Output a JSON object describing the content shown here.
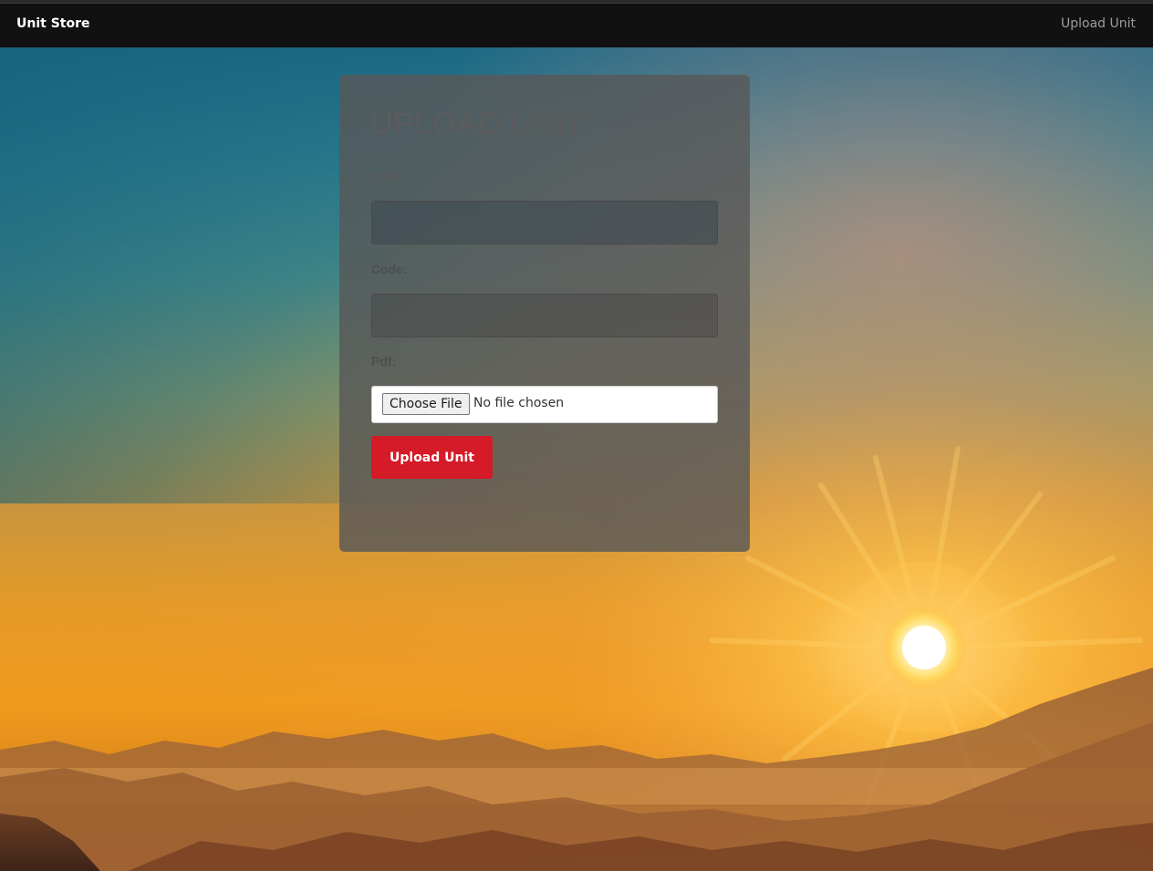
{
  "navbar": {
    "brand": "Unit Store",
    "upload_link": "Upload Unit"
  },
  "form": {
    "title": "UPLOAD UNIT",
    "fields": {
      "title_label": "Title:",
      "title_value": "",
      "code_label": "Code:",
      "code_value": "",
      "pdf_label": "Pdf:",
      "file_button": "Choose File",
      "file_status": "No file chosen"
    },
    "submit_label": "Upload Unit"
  },
  "colors": {
    "navbar_bg": "#111111",
    "submit_bg": "#d51a28",
    "panel_bg": "#585858"
  }
}
